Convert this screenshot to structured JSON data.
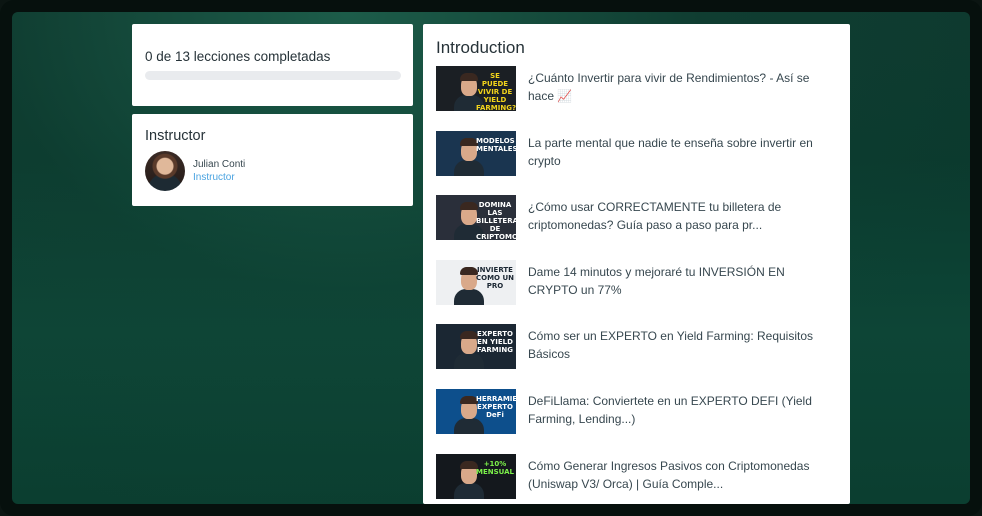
{
  "progress": {
    "label": "0 de 13 lecciones completadas",
    "completed": 0,
    "total": 13
  },
  "instructor": {
    "heading": "Instructor",
    "name": "Julian Conti",
    "role": "Instructor"
  },
  "section": {
    "title": "Introduction",
    "lessons": [
      {
        "title": "¿Cuánto Invertir para vivir de Rendimientos? - Así se hace 📈",
        "thumb_text": "SE PUEDE VIVIR DE YIELD FARMING?",
        "thumb_color": "#1b1f24"
      },
      {
        "title": "La parte mental que nadie te enseña sobre invertir en crypto",
        "thumb_text": "MODELOS MENTALES",
        "thumb_color": "#1a3550"
      },
      {
        "title": "¿Cómo usar CORRECTAMENTE tu billetera de criptomonedas? Guía paso a paso para pr...",
        "thumb_text": "DOMINA LAS BILLETERAS DE CRIPTOMONEDAS",
        "thumb_color": "#2a2f3a"
      },
      {
        "title": "Dame 14 minutos y mejoraré tu INVERSIÓN EN CRYPTO un 77%",
        "thumb_text": "INVIERTE COMO UN PRO",
        "thumb_color": "#eef0f2"
      },
      {
        "title": "Cómo ser un EXPERTO en Yield Farming: Requisitos Básicos",
        "thumb_text": "EXPERTO EN YIELD FARMING",
        "thumb_color": "#1b2733"
      },
      {
        "title": "DeFiLlama: Conviertete en un EXPERTO DEFI (Yield Farming, Lending...)",
        "thumb_text": "HERRAMIENTA EXPERTO DeFi",
        "thumb_color": "#0d4f8c"
      },
      {
        "title": "Cómo Generar Ingresos Pasivos con Criptomonedas (Uniswap V3/ Orca) | Guía Comple...",
        "thumb_text": "+10% MENSUAL",
        "thumb_color": "#14181d"
      }
    ]
  },
  "colors": {
    "accent": "#2f8f6f",
    "link": "#4aa3e0",
    "background": "#0e3a2f"
  }
}
